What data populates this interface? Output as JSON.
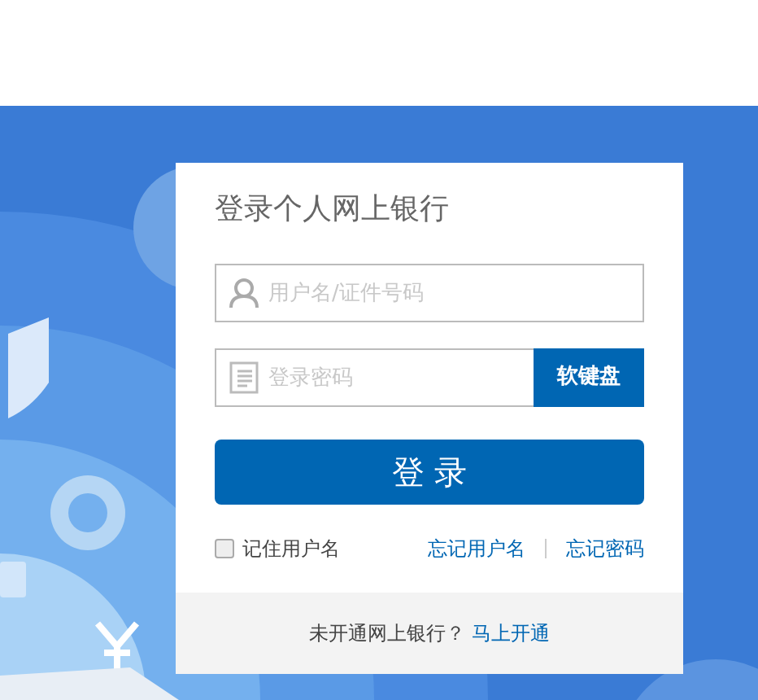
{
  "title": "登录个人网上银行",
  "username": {
    "placeholder": "用户名/证件号码"
  },
  "password": {
    "placeholder": "登录密码"
  },
  "soft_keyboard_button": "软键盘",
  "login_button": "登 录",
  "remember": {
    "label": "记住用户名",
    "checked": false
  },
  "links": [
    "忘记用户名",
    "忘记密码"
  ],
  "footer": {
    "text": "未开通网上银行？",
    "link": "马上开通"
  }
}
